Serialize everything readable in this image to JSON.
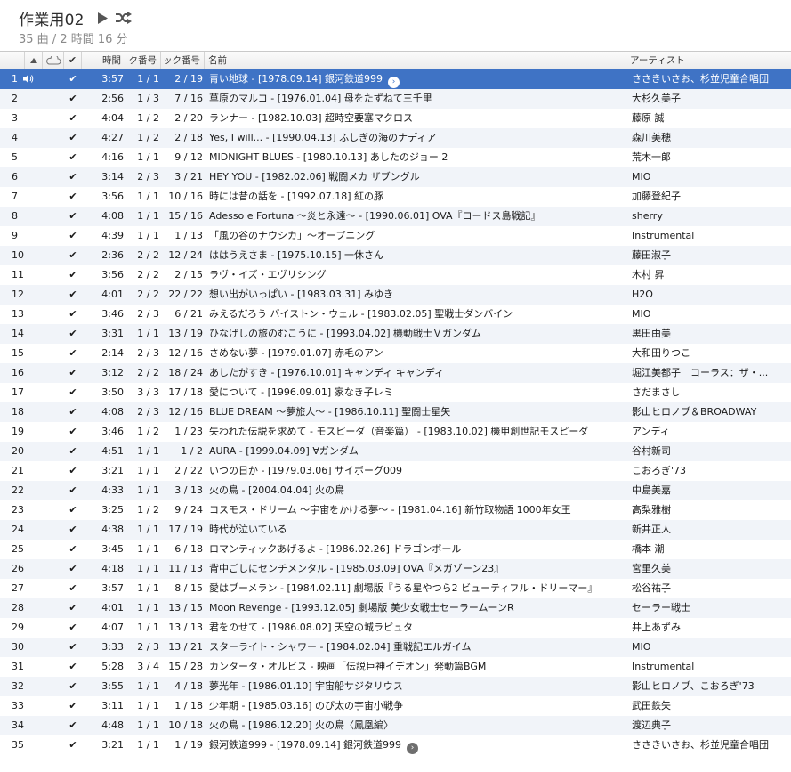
{
  "playlist": {
    "title": "作業用02",
    "summary": "35 曲 / 2 時間 16 分"
  },
  "columns": {
    "time": "時間",
    "disc": "ク番号",
    "track": "ック番号",
    "name": "名前",
    "artist": "アーティスト"
  },
  "colors": {
    "selected_row": "#3f73c5",
    "alt_row": "#f1f4f9"
  },
  "tracks": [
    {
      "num": "1",
      "time": "3:57",
      "disc": "1 / 1",
      "track": "2 / 19",
      "name": "青い地球 - [1978.09.14] 銀河鉄道999",
      "artist": "ささきいさお、杉並児童合唱団",
      "selected": true,
      "playing": true,
      "arrow": true
    },
    {
      "num": "2",
      "time": "2:56",
      "disc": "1 / 3",
      "track": "7 / 16",
      "name": "草原のマルコ - [1976.01.04] 母をたずねて三千里",
      "artist": "大杉久美子"
    },
    {
      "num": "3",
      "time": "4:04",
      "disc": "1 / 2",
      "track": "2 / 20",
      "name": "ランナー - [1982.10.03] 超時空要塞マクロス",
      "artist": "藤原 誠"
    },
    {
      "num": "4",
      "time": "4:27",
      "disc": "1 / 2",
      "track": "2 / 18",
      "name": "Yes, I will... - [1990.04.13] ふしぎの海のナディア",
      "artist": "森川美穂"
    },
    {
      "num": "5",
      "time": "4:16",
      "disc": "1 / 1",
      "track": "9 / 12",
      "name": "MIDNIGHT BLUES - [1980.10.13] あしたのジョー 2",
      "artist": "荒木一郎"
    },
    {
      "num": "6",
      "time": "3:14",
      "disc": "2 / 3",
      "track": "3 / 21",
      "name": "HEY YOU - [1982.02.06] 戦闘メカ ザブングル",
      "artist": "MIO"
    },
    {
      "num": "7",
      "time": "3:56",
      "disc": "1 / 1",
      "track": "10 / 16",
      "name": "時には昔の話を - [1992.07.18] 紅の豚",
      "artist": "加藤登紀子"
    },
    {
      "num": "8",
      "time": "4:08",
      "disc": "1 / 1",
      "track": "15 / 16",
      "name": "Adesso e Fortuna ～炎と永遠～ - [1990.06.01] OVA『ロードス島戦記』",
      "artist": "sherry"
    },
    {
      "num": "9",
      "time": "4:39",
      "disc": "1 / 1",
      "track": "1 / 13",
      "name": "「風の谷のナウシカ」～オープニング",
      "artist": "Instrumental"
    },
    {
      "num": "10",
      "time": "2:36",
      "disc": "2 / 2",
      "track": "12 / 24",
      "name": "ははうえさま - [1975.10.15] 一休さん",
      "artist": "藤田淑子"
    },
    {
      "num": "11",
      "time": "3:56",
      "disc": "2 / 2",
      "track": "2 / 15",
      "name": "ラヴ・イズ・エヴリシング",
      "artist": "木村 昇"
    },
    {
      "num": "12",
      "time": "4:01",
      "disc": "2 / 2",
      "track": "22 / 22",
      "name": "想い出がいっぱい - [1983.03.31] みゆき",
      "artist": "H2O"
    },
    {
      "num": "13",
      "time": "3:46",
      "disc": "2 / 3",
      "track": "6 / 21",
      "name": "みえるだろう バイストン・ウェル - [1983.02.05] 聖戦士ダンバイン",
      "artist": "MIO"
    },
    {
      "num": "14",
      "time": "3:31",
      "disc": "1 / 1",
      "track": "13 / 19",
      "name": "ひなげしの旅のむこうに - [1993.04.02] 機動戦士Ｖガンダム",
      "artist": "黒田由美"
    },
    {
      "num": "15",
      "time": "2:14",
      "disc": "2 / 3",
      "track": "12 / 16",
      "name": "さめない夢 - [1979.01.07] 赤毛のアン",
      "artist": "大和田りつこ"
    },
    {
      "num": "16",
      "time": "3:12",
      "disc": "2 / 2",
      "track": "18 / 24",
      "name": "あしたがすき - [1976.10.01] キャンディ キャンディ",
      "artist": "堀江美都子　コーラス：ザ・..."
    },
    {
      "num": "17",
      "time": "3:50",
      "disc": "3 / 3",
      "track": "17 / 18",
      "name": "愛について - [1996.09.01] 家なき子レミ",
      "artist": "さだまさし"
    },
    {
      "num": "18",
      "time": "4:08",
      "disc": "2 / 3",
      "track": "12 / 16",
      "name": "BLUE DREAM ～夢旅人～ - [1986.10.11] 聖闘士星矢",
      "artist": "影山ヒロノブ＆BROADWAY"
    },
    {
      "num": "19",
      "time": "3:46",
      "disc": "1 / 2",
      "track": "1 / 23",
      "name": "失われた伝説を求めて - モスピーダ（音楽篇） - [1983.10.02] 機甲創世記モスピーダ",
      "artist": "アンディ"
    },
    {
      "num": "20",
      "time": "4:51",
      "disc": "1 / 1",
      "track": "1 / 2",
      "name": "AURA - [1999.04.09] ∀ガンダム",
      "artist": "谷村新司"
    },
    {
      "num": "21",
      "time": "3:21",
      "disc": "1 / 1",
      "track": "2 / 22",
      "name": "いつの日か - [1979.03.06] サイボーグ009",
      "artist": "こおろぎ'73"
    },
    {
      "num": "22",
      "time": "4:33",
      "disc": "1 / 1",
      "track": "3 / 13",
      "name": "火の鳥 - [2004.04.04] 火の鳥",
      "artist": "中島美嘉"
    },
    {
      "num": "23",
      "time": "3:25",
      "disc": "1 / 2",
      "track": "9 / 24",
      "name": "コスモス・ドリーム ～宇宙をかける夢～ - [1981.04.16] 新竹取物語 1000年女王",
      "artist": "高梨雅樹"
    },
    {
      "num": "24",
      "time": "4:38",
      "disc": "1 / 1",
      "track": "17 / 19",
      "name": "時代が泣いている",
      "artist": "新井正人"
    },
    {
      "num": "25",
      "time": "3:45",
      "disc": "1 / 1",
      "track": "6 / 18",
      "name": "ロマンティックあげるよ - [1986.02.26] ドラゴンボール",
      "artist": "橋本 潮"
    },
    {
      "num": "26",
      "time": "4:18",
      "disc": "1 / 1",
      "track": "11 / 13",
      "name": "背中ごしにセンチメンタル - [1985.03.09] OVA『メガゾーン23』",
      "artist": "宮里久美"
    },
    {
      "num": "27",
      "time": "3:57",
      "disc": "1 / 1",
      "track": "8 / 15",
      "name": "愛はブーメラン - [1984.02.11] 劇場版『うる星やつら2 ビューティフル・ドリーマー』",
      "artist": "松谷祐子"
    },
    {
      "num": "28",
      "time": "4:01",
      "disc": "1 / 1",
      "track": "13 / 15",
      "name": "Moon Revenge - [1993.12.05] 劇場版 美少女戦士セーラームーンR",
      "artist": "セーラー戦士"
    },
    {
      "num": "29",
      "time": "4:07",
      "disc": "1 / 1",
      "track": "13 / 13",
      "name": "君をのせて - [1986.08.02] 天空の城ラピュタ",
      "artist": "井上あずみ"
    },
    {
      "num": "30",
      "time": "3:33",
      "disc": "2 / 3",
      "track": "13 / 21",
      "name": "スターライト・シャワー - [1984.02.04] 重戦記エルガイム",
      "artist": "MIO"
    },
    {
      "num": "31",
      "time": "5:28",
      "disc": "3 / 4",
      "track": "15 / 28",
      "name": "カンタータ・オルビス - 映画「伝説巨神イデオン」発動篇BGM",
      "artist": "Instrumental"
    },
    {
      "num": "32",
      "time": "3:55",
      "disc": "1 / 1",
      "track": "4 / 18",
      "name": "夢光年 - [1986.01.10] 宇宙船サジタリウス",
      "artist": "影山ヒロノブ、こおろぎ'73"
    },
    {
      "num": "33",
      "time": "3:11",
      "disc": "1 / 1",
      "track": "1 / 18",
      "name": "少年期 - [1985.03.16] のび太の宇宙小戦争",
      "artist": "武田鉄矢"
    },
    {
      "num": "34",
      "time": "4:48",
      "disc": "1 / 1",
      "track": "10 / 18",
      "name": "火の鳥 - [1986.12.20] 火の鳥〈鳳凰編〉",
      "artist": "渡辺典子"
    },
    {
      "num": "35",
      "time": "3:21",
      "disc": "1 / 1",
      "track": "1 / 19",
      "name": "銀河鉄道999 - [1978.09.14] 銀河鉄道999",
      "artist": "ささきいさお、杉並児童合唱団",
      "arrow": true
    }
  ]
}
